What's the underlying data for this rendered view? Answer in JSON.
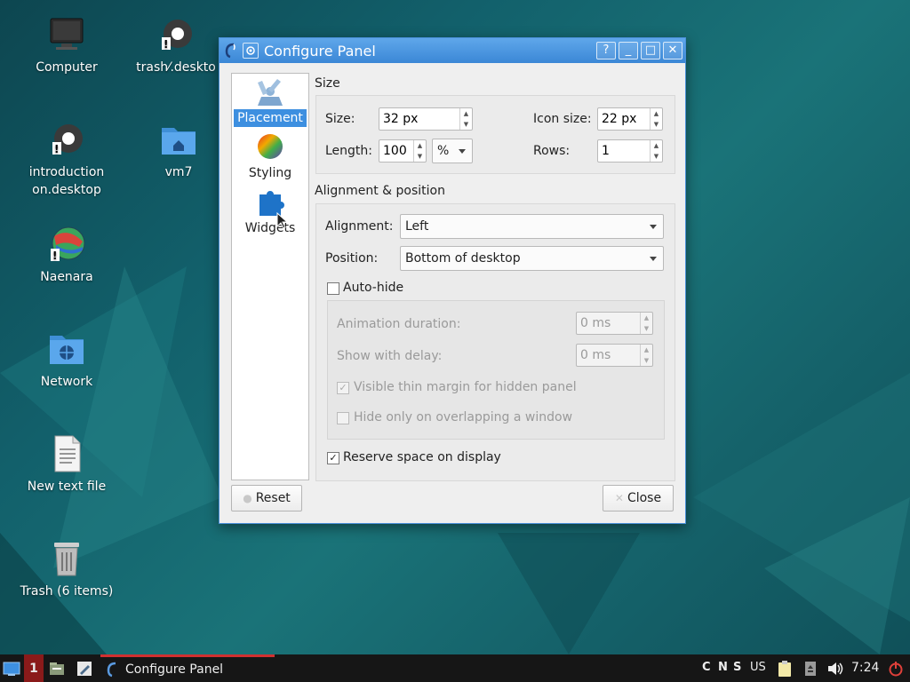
{
  "desktop": {
    "icons": [
      {
        "label": "Computer",
        "icon": "computer-icon"
      },
      {
        "label": "trash⁄.deskto",
        "icon": "gear-desktop-file-icon"
      },
      {
        "label": "introduction\non.desktop",
        "icon": "gear-desktop-file-icon"
      },
      {
        "label": "vm7",
        "icon": "home-folder-icon"
      },
      {
        "label": "Naenara",
        "icon": "browser-globe-icon"
      },
      {
        "label": "Network",
        "icon": "network-folder-icon"
      },
      {
        "label": "New text file",
        "icon": "text-file-icon"
      },
      {
        "label": "Trash (6 items)",
        "icon": "trash-icon"
      }
    ]
  },
  "window": {
    "title": "Configure Panel",
    "controls": {
      "help": "?",
      "minimize": "_",
      "maximize": "□",
      "close": "✕"
    },
    "sidebar": [
      {
        "label": "Placement",
        "icon": "placement-icon",
        "active": true
      },
      {
        "label": "Styling",
        "icon": "color-wheel-icon",
        "active": false
      },
      {
        "label": "Widgets",
        "icon": "puzzle-icon",
        "active": false
      }
    ],
    "size_section": {
      "title": "Size",
      "size_label": "Size:",
      "size_value": "32 px",
      "icon_size_label": "Icon size:",
      "icon_size_value": "22 px",
      "length_label": "Length:",
      "length_value": "100",
      "length_unit": "%",
      "rows_label": "Rows:",
      "rows_value": "1"
    },
    "alignment_section": {
      "title": "Alignment & position",
      "alignment_label": "Alignment:",
      "alignment_value": "Left",
      "position_label": "Position:",
      "position_value": "Bottom of desktop",
      "autohide_label": "Auto-hide",
      "autohide_checked": false,
      "animation_label": "Animation duration:",
      "animation_value": "0 ms",
      "delay_label": "Show with delay:",
      "delay_value": "0 ms",
      "thin_margin_label": "Visible thin margin for hidden panel",
      "thin_margin_checked": true,
      "overlap_label": "Hide only on overlapping a window",
      "overlap_checked": false,
      "reserve_label": "Reserve space on display",
      "reserve_checked": true
    },
    "buttons": {
      "reset": "Reset",
      "close": "Close"
    }
  },
  "taskbar": {
    "desktop_number": "1",
    "task_label": "Configure Panel",
    "tray": [
      "C",
      "N",
      "S"
    ],
    "keyboard_layout": "US",
    "clock": "7:24"
  },
  "colors": {
    "accent": "#3d8fe0",
    "taskbar": "#161616",
    "active_task": "#d03030",
    "desktop": "#12606b"
  }
}
